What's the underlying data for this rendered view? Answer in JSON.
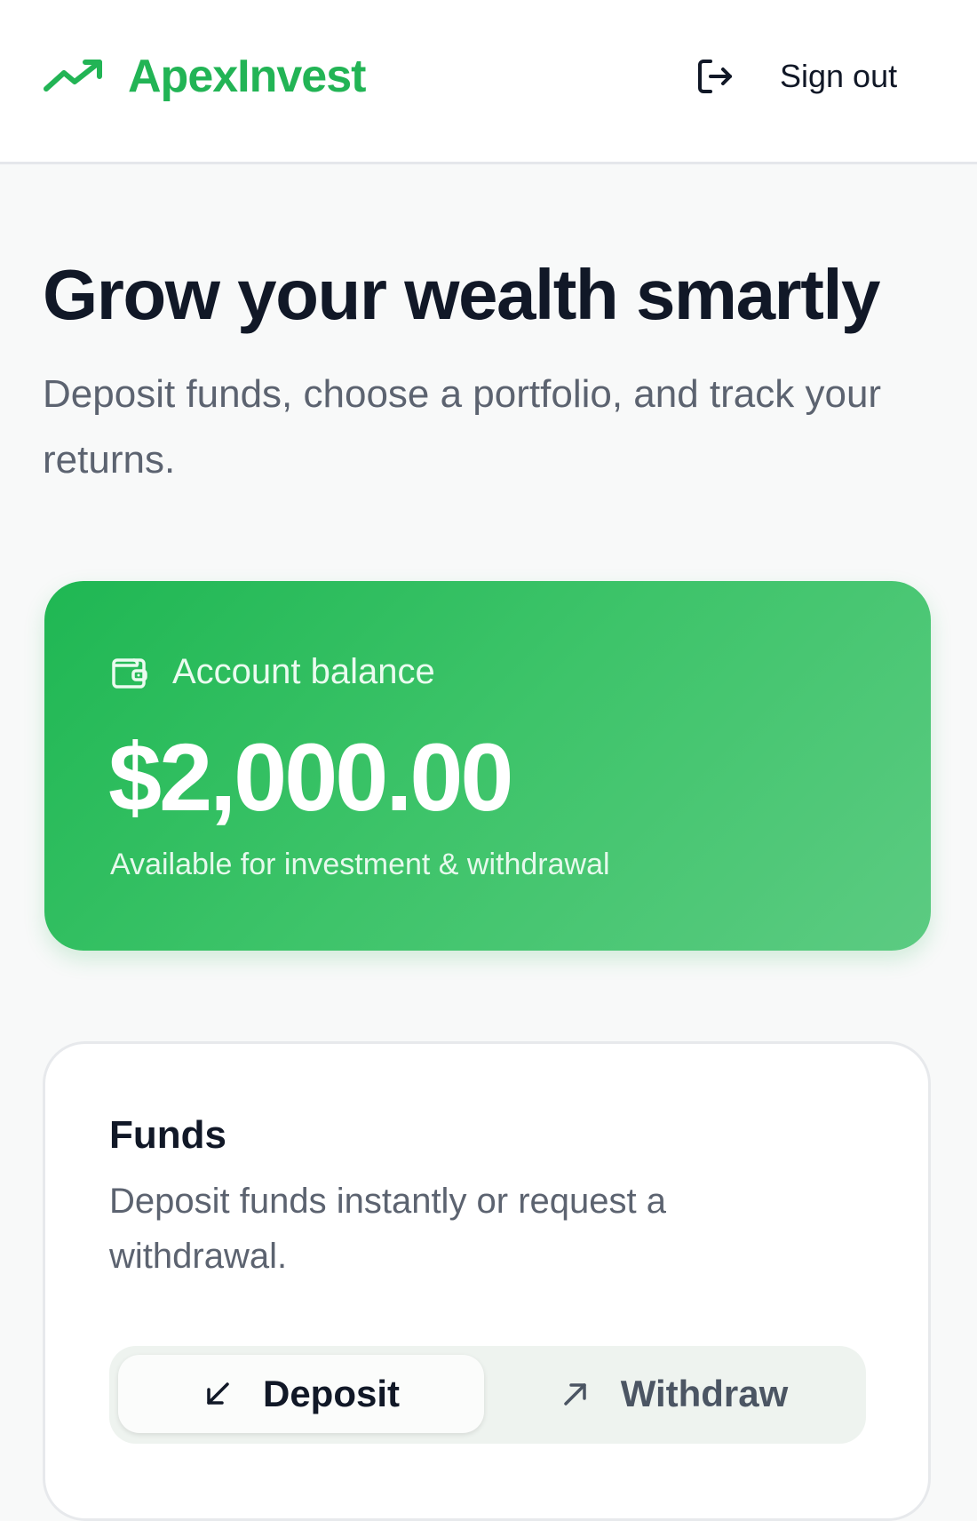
{
  "header": {
    "brand_name": "ApexInvest",
    "brand_icon": "trending-up-icon",
    "signout_label": "Sign out",
    "signout_icon": "log-out-icon"
  },
  "hero": {
    "title": "Grow your wealth smartly",
    "subtitle": "Deposit funds, choose a portfolio, and track your returns."
  },
  "balance_card": {
    "icon": "wallet-icon",
    "label": "Account balance",
    "value": "$2,000.00",
    "note": "Available for investment & withdrawal"
  },
  "funds": {
    "title": "Funds",
    "description": "Deposit funds instantly or request a withdrawal.",
    "tabs": [
      {
        "label": "Deposit",
        "icon": "arrow-down-left-icon",
        "selected": true
      },
      {
        "label": "Withdraw",
        "icon": "arrow-up-right-icon",
        "selected": false
      }
    ]
  },
  "colors": {
    "brand_green": "#22b455",
    "card_green_start": "#1fb753",
    "card_green_end": "#5ccb82",
    "text_dark": "#111827",
    "text_muted": "#5c6370"
  }
}
